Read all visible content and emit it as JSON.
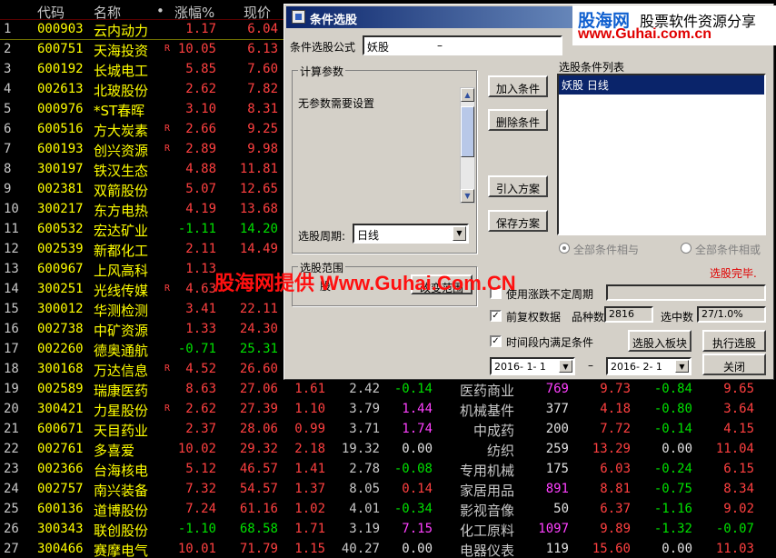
{
  "grid": {
    "headers": {
      "idx": "",
      "code": "代码",
      "name": "名称",
      "dot": "•",
      "chg": "涨幅%",
      "price": "现价"
    },
    "rows": [
      {
        "idx": "1",
        "code": "000903",
        "name": "云内动力",
        "mk": "",
        "chg": "1.17",
        "price": "6.04"
      },
      {
        "idx": "2",
        "code": "600751",
        "name": "天海投资",
        "mk": "R",
        "chg": "10.05",
        "price": "6.13"
      },
      {
        "idx": "3",
        "code": "600192",
        "name": "长城电工",
        "mk": "",
        "chg": "5.85",
        "price": "7.60"
      },
      {
        "idx": "4",
        "code": "002613",
        "name": "北玻股份",
        "mk": "",
        "chg": "2.62",
        "price": "7.82"
      },
      {
        "idx": "5",
        "code": "000976",
        "name": "*ST春晖",
        "mk": "",
        "chg": "3.10",
        "price": "8.31"
      },
      {
        "idx": "6",
        "code": "600516",
        "name": "方大炭素",
        "mk": "R",
        "chg": "2.66",
        "price": "9.25"
      },
      {
        "idx": "7",
        "code": "600193",
        "name": "创兴资源",
        "mk": "R",
        "chg": "2.89",
        "price": "9.98"
      },
      {
        "idx": "8",
        "code": "300197",
        "name": "铁汉生态",
        "mk": "",
        "chg": "4.88",
        "price": "11.81"
      },
      {
        "idx": "9",
        "code": "002381",
        "name": "双箭股份",
        "mk": "",
        "chg": "5.07",
        "price": "12.65"
      },
      {
        "idx": "10",
        "code": "300217",
        "name": "东方电热",
        "mk": "",
        "chg": "4.19",
        "price": "13.68"
      },
      {
        "idx": "11",
        "code": "600532",
        "name": "宏达矿业",
        "mk": "",
        "chg": "-1.11",
        "price": "14.20"
      },
      {
        "idx": "12",
        "code": "002539",
        "name": "新都化工",
        "mk": "",
        "chg": "2.11",
        "price": "14.49"
      },
      {
        "idx": "13",
        "code": "600967",
        "name": "上风高科",
        "mk": "",
        "chg": "1.13",
        "price": ""
      },
      {
        "idx": "14",
        "code": "300251",
        "name": "光线传媒",
        "mk": "R",
        "chg": "4.63",
        "price": ""
      },
      {
        "idx": "15",
        "code": "300012",
        "name": "华测检测",
        "mk": "",
        "chg": "3.41",
        "price": "22.11"
      },
      {
        "idx": "16",
        "code": "002738",
        "name": "中矿资源",
        "mk": "",
        "chg": "1.33",
        "price": "24.30"
      },
      {
        "idx": "17",
        "code": "002260",
        "name": "德奥通航",
        "mk": "",
        "chg": "-0.71",
        "price": "25.31"
      },
      {
        "idx": "18",
        "code": "300168",
        "name": "万达信息",
        "mk": "R",
        "chg": "4.52",
        "price": "26.60"
      },
      {
        "idx": "19",
        "code": "002589",
        "name": "瑞康医药",
        "mk": "",
        "chg": "8.63",
        "price": "27.06",
        "c5": "1.61",
        "c6": "2.42",
        "c7": "-0.14",
        "ind": "医药商业",
        "c9": "769",
        "c10": "9.73",
        "c11": "-0.84",
        "c12": "9.65"
      },
      {
        "idx": "20",
        "code": "300421",
        "name": "力星股份",
        "mk": "R",
        "chg": "2.62",
        "price": "27.39",
        "c5": "1.10",
        "c6": "3.79",
        "c7": "1.44",
        "ind": "机械基件",
        "c9": "377",
        "c10": "4.18",
        "c11": "-0.80",
        "c12": "3.64"
      },
      {
        "idx": "21",
        "code": "600671",
        "name": "天目药业",
        "mk": "",
        "chg": "2.37",
        "price": "28.06",
        "c5": "0.99",
        "c6": "3.71",
        "c7": "1.74",
        "ind": "中成药",
        "c9": "200",
        "c10": "7.72",
        "c11": "-0.14",
        "c12": "4.15"
      },
      {
        "idx": "22",
        "code": "002761",
        "name": "多喜爱",
        "mk": "",
        "chg": "10.02",
        "price": "29.32",
        "c5": "2.18",
        "c6": "19.32",
        "c7": "0.00",
        "ind": "纺织",
        "c9": "259",
        "c10": "13.29",
        "c11": "0.00",
        "c12": "11.04"
      },
      {
        "idx": "23",
        "code": "002366",
        "name": "台海核电",
        "mk": "",
        "chg": "5.12",
        "price": "46.57",
        "c5": "1.41",
        "c6": "2.78",
        "c7": "-0.08",
        "ind": "专用机械",
        "c9": "175",
        "c10": "6.03",
        "c11": "-0.24",
        "c12": "6.15"
      },
      {
        "idx": "24",
        "code": "002757",
        "name": "南兴装备",
        "mk": "",
        "chg": "7.32",
        "price": "54.57",
        "c5": "1.37",
        "c6": "8.05",
        "c7": "0.14",
        "ind": "家居用品",
        "c9": "891",
        "c10": "8.81",
        "c11": "-0.75",
        "c12": "8.34"
      },
      {
        "idx": "25",
        "code": "600136",
        "name": "道博股份",
        "mk": "",
        "chg": "7.24",
        "price": "61.16",
        "c5": "1.02",
        "c6": "4.01",
        "c7": "-0.34",
        "ind": "影视音像",
        "c9": "50",
        "c10": "6.37",
        "c11": "-1.16",
        "c12": "9.02"
      },
      {
        "idx": "26",
        "code": "300343",
        "name": "联创股份",
        "mk": "",
        "chg": "-1.10",
        "price": "68.58",
        "c5": "1.71",
        "c6": "3.19",
        "c7": "7.15",
        "ind": "化工原料",
        "c9": "1097",
        "c10": "9.89",
        "c11": "-1.32",
        "c12": "-0.07"
      },
      {
        "idx": "27",
        "code": "300466",
        "name": "赛摩电气",
        "mk": "",
        "chg": "10.01",
        "price": "71.79",
        "c5": "1.15",
        "c6": "40.27",
        "c7": "0.00",
        "ind": "电器仪表",
        "c9": "119",
        "c10": "15.60",
        "c11": "0.00",
        "c12": "11.03"
      }
    ]
  },
  "dialog": {
    "title": "条件选股",
    "formula_label": "条件选股公式",
    "formula_value": "妖股",
    "formula_dash": "–",
    "calc_group": "计算参数",
    "no_params": "无参数需要设置",
    "period_label": "选股周期:",
    "period_value": "日线",
    "range_group": "选股范围",
    "range_btn_left": "股",
    "range_btn": "改变范围",
    "add_btn": "加入条件",
    "del_btn": "删除条件",
    "import_btn": "引入方案",
    "save_btn": "保存方案",
    "list_label": "选股条件列表",
    "list_item": "妖股    日线",
    "radio_and": "全部条件相与",
    "radio_or": "全部条件相或",
    "status": "选股完毕.",
    "uncertain_label": "使用涨跌不定周期",
    "fq_label": "前复权数据",
    "count_label": "品种数",
    "count_value": "2816",
    "hit_label": "选中数",
    "hit_value": "27/1.0%",
    "time_label": "时间段内满足条件",
    "to_board_btn": "选股入板块",
    "run_btn": "执行选股",
    "date_from": "2016- 1- 1",
    "date_sep": "–",
    "date_to": "2016- 2- 1",
    "close_btn": "关闭"
  },
  "watermark": {
    "brand": "股海网",
    "tagline": "股票软件资源分享",
    "url": "www.Guhai.com.cn",
    "center_cn": "股海网提供",
    "center_url": " Www.Guhai.Com.CN"
  },
  "colors": {
    "up": "#ff4040",
    "down": "#00e000",
    "code": "#ffff00",
    "titlebar": "#0a246a"
  }
}
